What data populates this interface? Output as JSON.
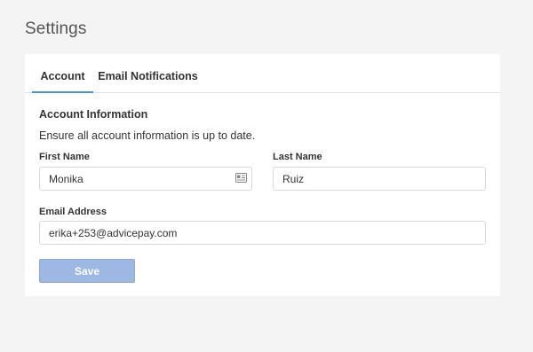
{
  "page": {
    "title": "Settings"
  },
  "tabs": {
    "account": "Account",
    "email_notifications": "Email Notifications",
    "active": "Account"
  },
  "account_section": {
    "title": "Account Information",
    "description": "Ensure all account information is up to date."
  },
  "form": {
    "first_name_label": "First Name",
    "first_name_value": "Monika",
    "last_name_label": "Last Name",
    "last_name_value": "Ruiz",
    "email_label": "Email Address",
    "email_value": "erika+253@advicepay.com",
    "save_label": "Save"
  },
  "icons": {
    "first_name_field": "contact-card-icon"
  },
  "colors": {
    "accent": "#4a90d9",
    "save_button": "#9db8e3",
    "background": "#f4f4f4"
  }
}
